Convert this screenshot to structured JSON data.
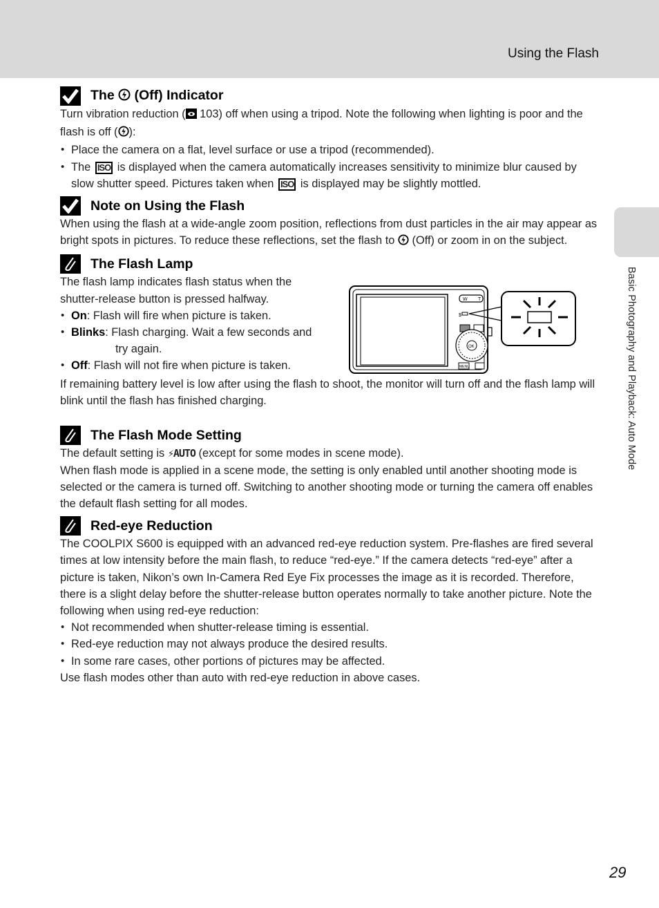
{
  "header": {
    "title": "Using the Flash"
  },
  "side_tab": {
    "label": "Basic Photography and Playback: Auto Mode"
  },
  "page_number": "29",
  "sections": {
    "off_indicator": {
      "title_pre": "The",
      "title_post": "(Off) Indicator",
      "p1_a": "Turn vibration reduction (",
      "p1_ref": "103",
      "p1_b": ") off when using a tripod. Note the following when lighting is poor and the flash is off (",
      "p1_c": "):",
      "bullet1": "Place the camera on a flat, level surface or use a tripod (recommended).",
      "bullet2_a": "The",
      "bullet2_b": "is displayed when the camera automatically increases sensitivity to minimize blur caused by slow shutter speed. Pictures taken when",
      "bullet2_c": "is displayed may be slightly mottled.",
      "iso_label": "ISO"
    },
    "note_flash": {
      "title": "Note on Using the Flash",
      "p1_a": "When using the flash at a wide-angle zoom position, reflections from dust particles in the air may appear as bright spots in pictures. To reduce these reflections, set the flash to",
      "p1_b": "(Off) or zoom in on the subject."
    },
    "flash_lamp": {
      "title": "The Flash Lamp",
      "intro": "The flash lamp indicates flash status when the shutter-release button is pressed halfway.",
      "items": [
        {
          "term": "On",
          "desc": ":  Flash will fire when picture is taken."
        },
        {
          "term": "Blinks",
          "desc": ":  Flash charging. Wait a few seconds and",
          "cont": "try again."
        },
        {
          "term": "Off",
          "desc": ": Flash will not fire when picture is taken."
        }
      ],
      "outro": "If remaining battery level is low after using the flash to shoot, the monitor will turn off and the flash lamp will blink until the flash has finished charging.",
      "figure_labels": {
        "zoom_w": "W",
        "zoom_t": "T",
        "ok": "OK",
        "menu": "MENU"
      }
    },
    "flash_mode": {
      "title": "The Flash Mode Setting",
      "p1_a": "The default setting is",
      "p1_icon": "AUTO",
      "p1_b": "(except for some modes in scene mode).",
      "p2": "When flash mode is applied in a scene mode, the setting is only enabled until another shooting mode is selected or the camera is turned off. Switching to another shooting mode or turning the camera off enables the default flash setting for all modes."
    },
    "red_eye": {
      "title": "Red-eye Reduction",
      "p1": "The COOLPIX S600 is equipped with an advanced red-eye reduction system. Pre-flashes are fired several times at low intensity before the main flash, to reduce “red-eye.” If the camera detects “red-eye” after a picture is taken, Nikon’s own In-Camera Red Eye Fix processes the image as it is recorded. Therefore, there is a slight delay before the shutter-release button operates normally to take another picture. Note the following when using red-eye reduction:",
      "bullets": [
        "Not recommended when shutter-release timing is essential.",
        "Red-eye reduction may not always produce the desired results.",
        "In some rare cases, other portions of pictures may be affected."
      ],
      "outro": "Use flash modes other than auto with red-eye reduction in above cases."
    }
  }
}
